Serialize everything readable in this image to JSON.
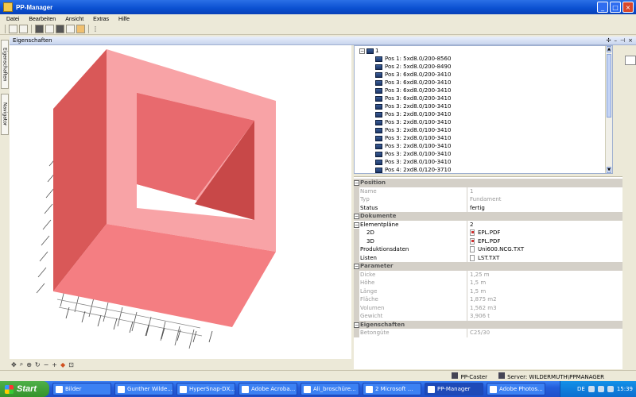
{
  "window": {
    "title": "PP-Manager"
  },
  "menu": [
    "Datei",
    "Bearbeiten",
    "Ansicht",
    "Extras",
    "Hilfe"
  ],
  "side_tabs": [
    "Eigenschaften",
    "Navigator"
  ],
  "panel": {
    "title": "Eigenschaften"
  },
  "tree": {
    "root_label": "1",
    "items": [
      "Pos 1: 5xd8.0/200-8560",
      "Pos 2: 5xd8.0/200-8490",
      "Pos 3: 6xd8.0/200-3410",
      "Pos 3: 6xd8.0/200-3410",
      "Pos 3: 6xd8.0/200-3410",
      "Pos 3: 6xd8.0/200-3410",
      "Pos 3: 2xd8.0/100-3410",
      "Pos 3: 2xd8.0/100-3410",
      "Pos 3: 2xd8.0/100-3410",
      "Pos 3: 2xd8.0/100-3410",
      "Pos 3: 2xd8.0/100-3410",
      "Pos 3: 2xd8.0/100-3410",
      "Pos 3: 2xd8.0/100-3410",
      "Pos 3: 2xd8.0/100-3410",
      "Pos 4: 2xd8.0/120-3710"
    ]
  },
  "props": {
    "position": {
      "title": "Position",
      "name_key": "Name",
      "name_val": "1",
      "typ_key": "Typ",
      "typ_val": "Fundament",
      "status_key": "Status",
      "status_val": "fertig"
    },
    "dokumente": {
      "title": "Dokumente",
      "elementplaene_key": "Elementpläne",
      "elementplaene_val": "2",
      "d2_key": "2D",
      "d2_val": "EPL.PDF",
      "d3_key": "3D",
      "d3_val": "EPL.PDF",
      "produktion_key": "Produktionsdaten",
      "produktion_val": "Uni600.NCG.TXT",
      "listen_key": "Listen",
      "listen_val": "LST.TXT"
    },
    "parameter": {
      "title": "Parameter",
      "dicke_key": "Dicke",
      "dicke_val": "1,25 m",
      "hoehe_key": "Höhe",
      "hoehe_val": "1,5 m",
      "laenge_key": "Länge",
      "laenge_val": "1,5 m",
      "flaeche_key": "Fläche",
      "flaeche_val": "1,875 m2",
      "volumen_key": "Volumen",
      "volumen_val": "1,562 m3",
      "gewicht_key": "Gewicht",
      "gewicht_val": "3,906 t"
    },
    "eigenschaften": {
      "title": "Eigenschaften",
      "beton_key": "Betongüte",
      "beton_val": "C25/30"
    }
  },
  "status": {
    "caster": "PP-Caster",
    "server": "Server: WILDERMUTH\\PPMANAGER"
  },
  "taskbar": {
    "start": "Start",
    "tasks": [
      "Bilder",
      "Gunther Wilde...",
      "HyperSnap-DX...",
      "Adobe Acroba...",
      "Ali_broschüre...",
      "2 Microsoft ...",
      "PP-Manager",
      "Adobe Photos..."
    ],
    "lang": "DE",
    "clock": "15:39"
  },
  "colors": {
    "box_front": "#f47e82",
    "box_top": "#f8a3a6",
    "box_side": "#d95858",
    "box_inner": "#c84848",
    "titlebar": "#0a4fd0"
  }
}
